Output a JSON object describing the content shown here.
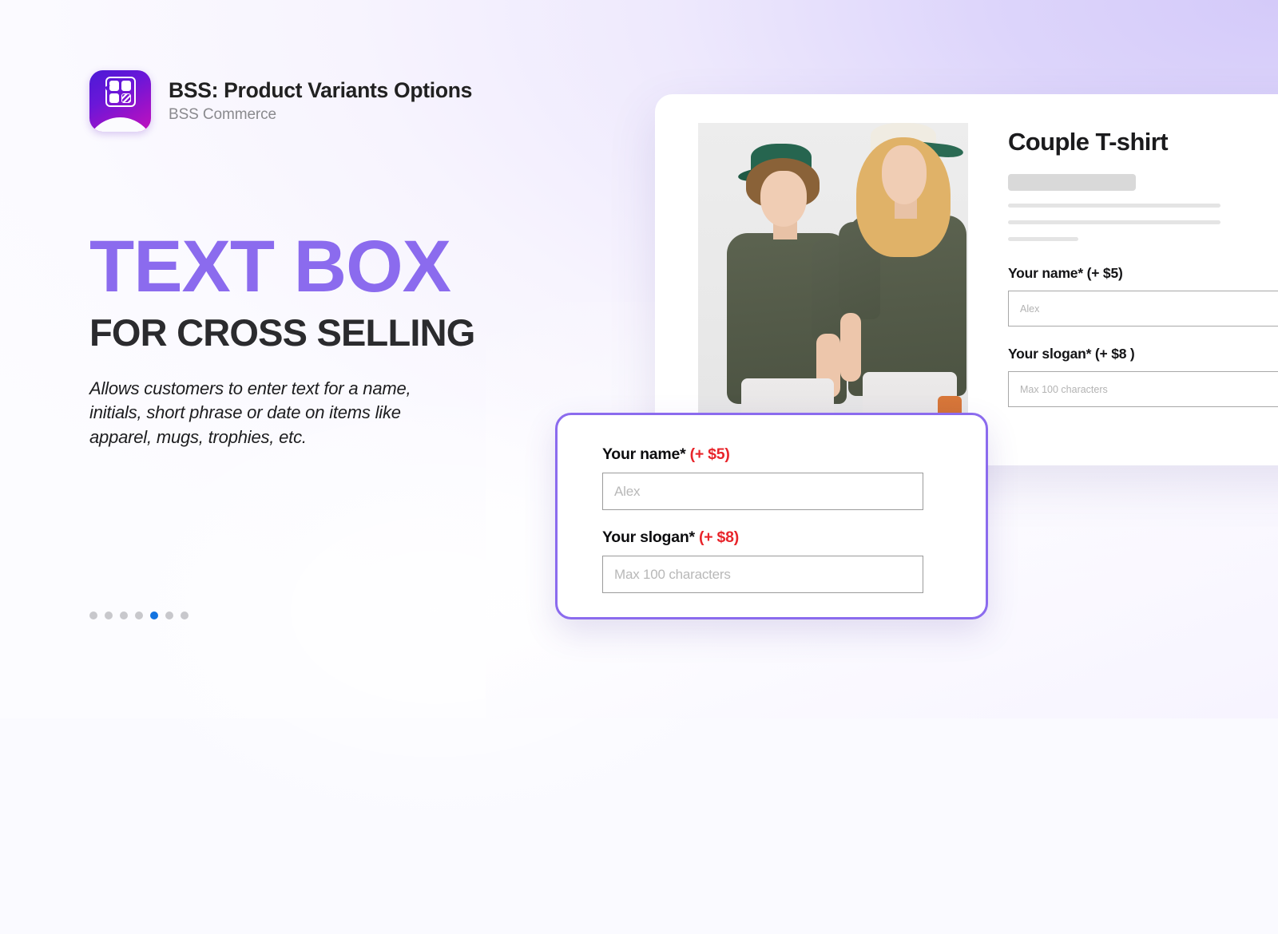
{
  "brand": {
    "logo_icon": "bss-app-icon",
    "logo_word": "BSS",
    "title": "BSS: Product Variants Options",
    "subtitle": "BSS Commerce"
  },
  "hero": {
    "headline": "TEXT BOX",
    "subheadline": "FOR CROSS SELLING",
    "description": "Allows customers to enter text for a name, initials, short phrase or date on items like apparel, mugs, trophies, etc.",
    "headline_color": "#8b6bee",
    "subheadline_color": "#2b2b2e"
  },
  "carousel": {
    "total_dots": 7,
    "active_index": 5,
    "active_color": "#1273e0",
    "inactive_color": "#c8c8cc"
  },
  "product_card": {
    "title": "Couple T-shirt",
    "image_alt": "couple-wearing-olive-tshirts-photo",
    "fields": [
      {
        "label": "Your name* (+ $5)",
        "value": "",
        "placeholder": "Alex"
      },
      {
        "label": "Your slogan* (+ $8 )",
        "value": "",
        "placeholder": "Max 100 characters"
      }
    ]
  },
  "popup": {
    "border_color": "#8b6bee",
    "price_color": "#e8252b",
    "fields": [
      {
        "label": "Your name*",
        "price": "(+ $5)",
        "value": "",
        "placeholder": "Alex"
      },
      {
        "label": "Your slogan*",
        "price": "(+ $8)",
        "value": "",
        "placeholder": "Max 100 characters"
      }
    ]
  }
}
